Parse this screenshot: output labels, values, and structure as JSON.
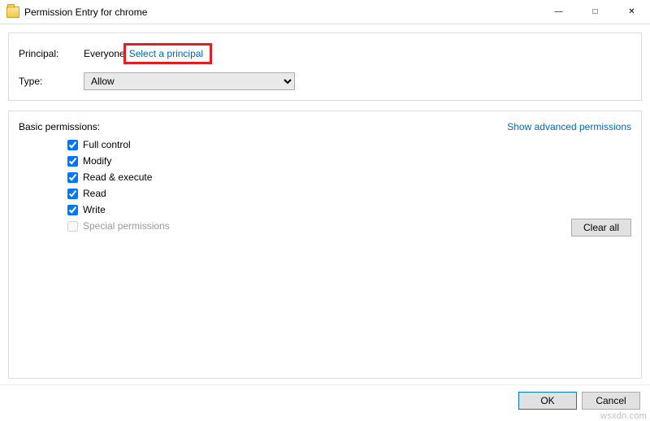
{
  "window": {
    "title": "Permission Entry for chrome"
  },
  "principal": {
    "label": "Principal:",
    "value": "Everyone",
    "select_link": "Select a principal"
  },
  "type": {
    "label": "Type:",
    "value": "Allow"
  },
  "permissions": {
    "header": "Basic permissions:",
    "advanced_link": "Show advanced permissions",
    "items": [
      {
        "label": "Full control",
        "checked": true,
        "enabled": true
      },
      {
        "label": "Modify",
        "checked": true,
        "enabled": true
      },
      {
        "label": "Read & execute",
        "checked": true,
        "enabled": true
      },
      {
        "label": "Read",
        "checked": true,
        "enabled": true
      },
      {
        "label": "Write",
        "checked": true,
        "enabled": true
      },
      {
        "label": "Special permissions",
        "checked": false,
        "enabled": false
      }
    ],
    "clear_all": "Clear all"
  },
  "footer": {
    "ok": "OK",
    "cancel": "Cancel"
  },
  "watermark": "wsxdn.com"
}
